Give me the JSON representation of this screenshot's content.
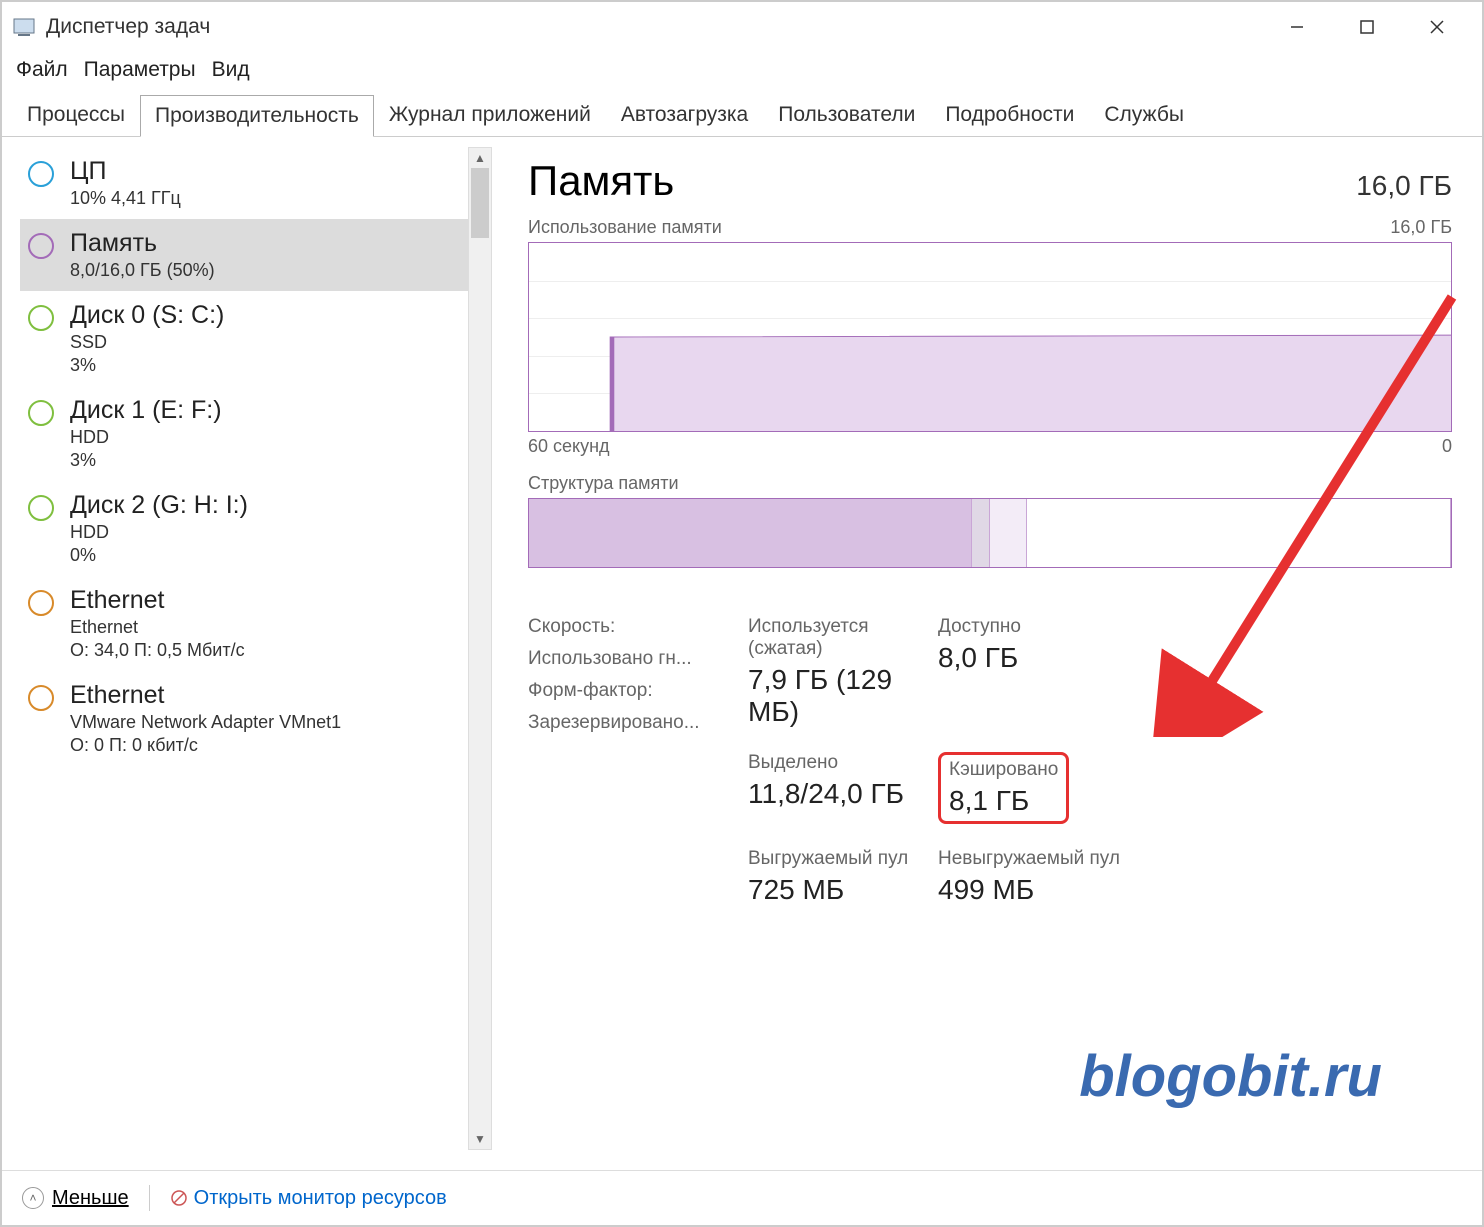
{
  "window": {
    "title": "Диспетчер задач"
  },
  "menubar": [
    "Файл",
    "Параметры",
    "Вид"
  ],
  "tabs": [
    "Процессы",
    "Производительность",
    "Журнал приложений",
    "Автозагрузка",
    "Пользователи",
    "Подробности",
    "Службы"
  ],
  "active_tab_index": 1,
  "sidebar": [
    {
      "title": "ЦП",
      "sub1": "10% 4,41 ГГц",
      "sub2": "",
      "color": "#2aa0d8",
      "selected": false
    },
    {
      "title": "Память",
      "sub1": "8,0/16,0 ГБ (50%)",
      "sub2": "",
      "color": "#a36bb8",
      "selected": true
    },
    {
      "title": "Диск 0 (S: C:)",
      "sub1": "SSD",
      "sub2": "3%",
      "color": "#7fbf3f",
      "selected": false
    },
    {
      "title": "Диск 1 (E: F:)",
      "sub1": "HDD",
      "sub2": "3%",
      "color": "#7fbf3f",
      "selected": false
    },
    {
      "title": "Диск 2 (G: H: I:)",
      "sub1": "HDD",
      "sub2": "0%",
      "color": "#7fbf3f",
      "selected": false
    },
    {
      "title": "Ethernet",
      "sub1": "Ethernet",
      "sub2": "О: 34,0 П: 0,5 Мбит/с",
      "color": "#d88a2a",
      "selected": false
    },
    {
      "title": "Ethernet",
      "sub1": "VMware Network Adapter VMnet1",
      "sub2": "О: 0 П: 0 кбит/с",
      "color": "#d88a2a",
      "selected": false
    }
  ],
  "main": {
    "heading": "Память",
    "capacity": "16,0 ГБ",
    "chart_title": "Использование памяти",
    "chart_max": "16,0 ГБ",
    "xaxis_left": "60 секунд",
    "xaxis_right": "0",
    "comp_title": "Структура памяти",
    "composition_pct": {
      "used": 48,
      "modified": 2,
      "standby": 4,
      "free": 46
    },
    "stats": {
      "in_use_label": "Используется (сжатая)",
      "in_use_value": "7,9 ГБ (129 МБ)",
      "available_label": "Доступно",
      "available_value": "8,0 ГБ",
      "committed_label": "Выделено",
      "committed_value": "11,8/24,0 ГБ",
      "cached_label": "Кэшировано",
      "cached_value": "8,1 ГБ",
      "paged_label": "Выгружаемый пул",
      "paged_value": "725 МБ",
      "nonpaged_label": "Невыгружаемый пул",
      "nonpaged_value": "499 МБ"
    },
    "side_stats": [
      "Скорость:",
      "Использовано гн...",
      "Форм-фактор:",
      "Зарезервировано..."
    ]
  },
  "footer": {
    "fewer": "Меньше",
    "resmon": "Открыть монитор ресурсов"
  },
  "watermark": "blogobit.ru",
  "chart_data": {
    "type": "area",
    "title": "Использование памяти",
    "ylabel": "ГБ",
    "ylim": [
      0,
      16
    ],
    "xlabel": "секунд",
    "xlim": [
      60,
      0
    ],
    "series": [
      {
        "name": "Используется",
        "x": [
          60,
          55,
          50,
          45,
          40,
          35,
          30,
          25,
          20,
          15,
          10,
          5,
          0
        ],
        "values": [
          0,
          0,
          0,
          8.0,
          8.0,
          8.0,
          8.0,
          8.0,
          8.0,
          8.0,
          8.0,
          8.0,
          8.0
        ]
      }
    ]
  }
}
